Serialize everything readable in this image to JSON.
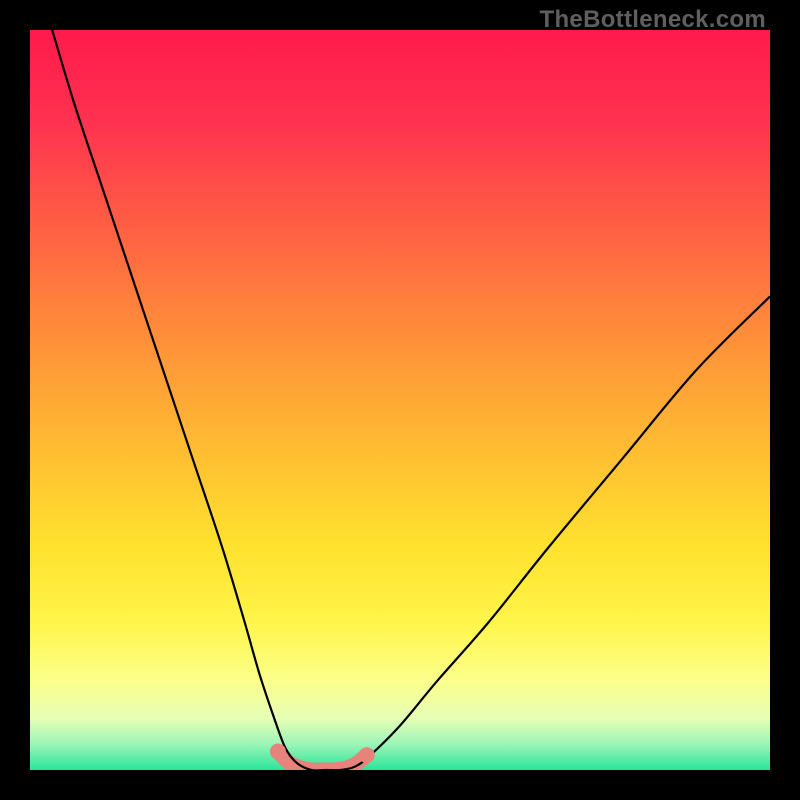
{
  "watermark": {
    "text": "TheBottleneck.com"
  },
  "colors": {
    "bg_black": "#000000",
    "curve_stroke": "#000000",
    "pink_marker": "#e8837b",
    "gradient_stops": [
      {
        "offset": 0.0,
        "color": "#ff1a4b"
      },
      {
        "offset": 0.12,
        "color": "#ff3150"
      },
      {
        "offset": 0.25,
        "color": "#ff5a45"
      },
      {
        "offset": 0.4,
        "color": "#ff8a3a"
      },
      {
        "offset": 0.55,
        "color": "#ffb833"
      },
      {
        "offset": 0.7,
        "color": "#ffe22e"
      },
      {
        "offset": 0.8,
        "color": "#fff54a"
      },
      {
        "offset": 0.88,
        "color": "#fbff8c"
      },
      {
        "offset": 0.93,
        "color": "#e6ffb5"
      },
      {
        "offset": 0.965,
        "color": "#9cf5b8"
      },
      {
        "offset": 1.0,
        "color": "#28e59a"
      }
    ]
  },
  "chart_data": {
    "type": "line",
    "title": "",
    "xlabel": "",
    "ylabel": "",
    "xlim": [
      0,
      100
    ],
    "ylim": [
      0,
      100
    ],
    "grid": false,
    "legend": false,
    "series": [
      {
        "name": "bottleneck-curve",
        "x": [
          3,
          6,
          10,
          14,
          18,
          22,
          26,
          29,
          31,
          33,
          34.5,
          36,
          38,
          40,
          42,
          44,
          46,
          50,
          55,
          62,
          70,
          80,
          90,
          100
        ],
        "y": [
          100,
          90,
          78,
          66,
          54,
          42,
          30,
          20,
          13,
          7,
          3,
          1,
          0,
          0,
          0,
          0.5,
          2,
          6,
          12,
          20,
          30,
          42,
          54,
          64
        ]
      }
    ],
    "markers": {
      "name": "trough-markers",
      "x": [
        33.5,
        35,
        36.5,
        38,
        39.5,
        41,
        42.5,
        44,
        45.5
      ],
      "y": [
        2.5,
        1.0,
        0.3,
        0.0,
        0.0,
        0.0,
        0.2,
        0.8,
        2.0
      ]
    }
  }
}
